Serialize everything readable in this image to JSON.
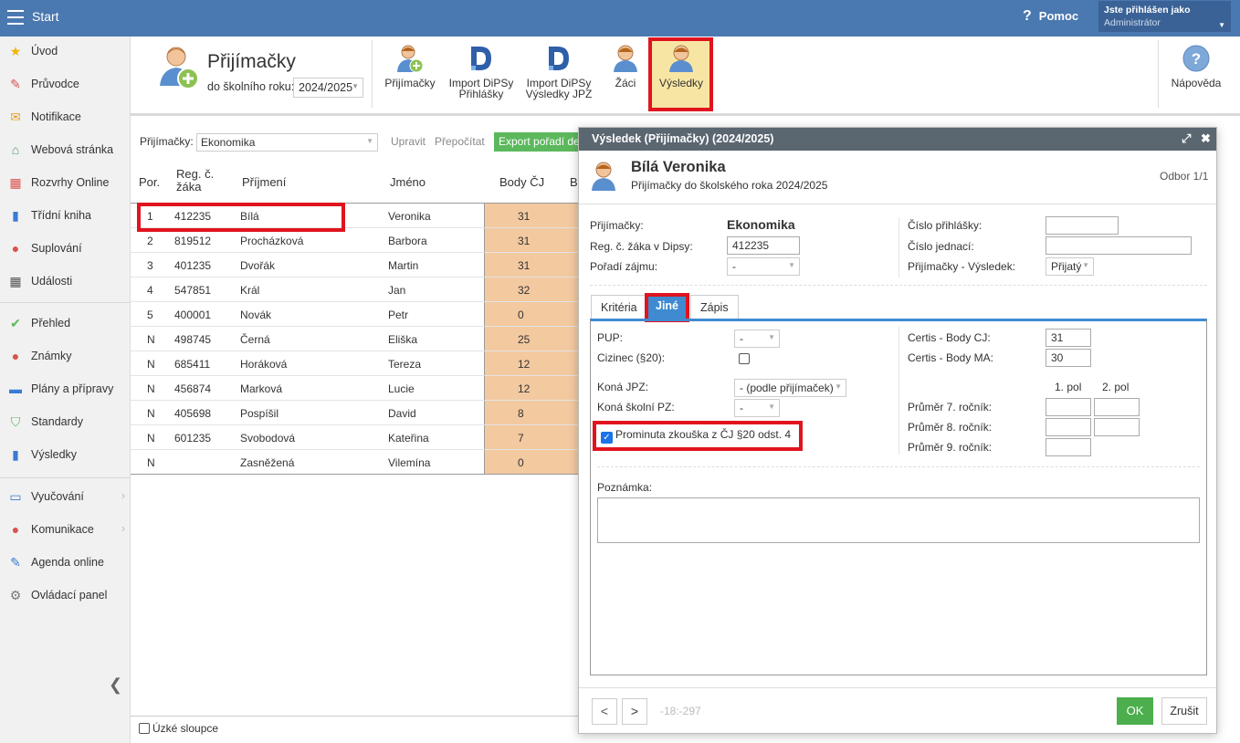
{
  "app": {
    "title": "Start",
    "help": "Pomoc",
    "help_q": "?",
    "user_line1": "Jste přihlášen jako",
    "user_line2": "Administrátor"
  },
  "sidebar": {
    "items": [
      {
        "label": "Úvod",
        "icon": "star-icon"
      },
      {
        "label": "Průvodce",
        "icon": "magic-wand-icon"
      },
      {
        "label": "Notifikace",
        "icon": "envelope-icon"
      },
      {
        "label": "Webová stránka",
        "icon": "home-icon"
      },
      {
        "label": "Rozvrhy Online",
        "icon": "calendar-icon"
      },
      {
        "label": "Třídní kniha",
        "icon": "book-icon"
      },
      {
        "label": "Suplování",
        "icon": "person-icon"
      },
      {
        "label": "Události",
        "icon": "calendar-grid-icon"
      },
      {
        "label": "Přehled",
        "icon": "check-circle-icon"
      },
      {
        "label": "Známky",
        "icon": "grade-icon"
      },
      {
        "label": "Plány a přípravy",
        "icon": "briefcase-icon"
      },
      {
        "label": "Standardy",
        "icon": "shield-icon"
      },
      {
        "label": "Výsledky",
        "icon": "bar-chart-icon"
      },
      {
        "label": "Vyučování",
        "icon": "book-open-icon"
      },
      {
        "label": "Komunikace",
        "icon": "chat-icon"
      },
      {
        "label": "Agenda online",
        "icon": "pen-icon"
      },
      {
        "label": "Ovládací panel",
        "icon": "gear-icon"
      }
    ]
  },
  "toolbar": {
    "title": "Přijímačky",
    "year_label": "do školního roku:",
    "year_value": "2024/2025",
    "btn_prijimacky": "Přijímačky",
    "btn_import1_l1": "Import DiPSy",
    "btn_import1_l2": "Přihlášky",
    "btn_import2_l1": "Import DiPSy",
    "btn_import2_l2": "Výsledky JPZ",
    "btn_zaci": "Žáci",
    "btn_vysledky": "Výsledky",
    "btn_napoveda": "Nápověda"
  },
  "list": {
    "filter_label": "Přijímačky:",
    "filter_value": "Ekonomika",
    "upravit": "Upravit",
    "prepocitat": "Přepočítat",
    "export": "Export pořadí de",
    "headers": {
      "por": "Por.",
      "reg1": "Reg. č.",
      "reg2": "žáka",
      "prijmeni": "Příjmení",
      "jmeno": "Jméno",
      "body_cj": "Body ČJ",
      "b": "B"
    },
    "rows": [
      {
        "por": "1",
        "reg": "412235",
        "prijmeni": "Bílá",
        "jmeno": "Veronika",
        "body": "31"
      },
      {
        "por": "2",
        "reg": "819512",
        "prijmeni": "Procházková",
        "jmeno": "Barbora",
        "body": "31"
      },
      {
        "por": "3",
        "reg": "401235",
        "prijmeni": "Dvořák",
        "jmeno": "Martin",
        "body": "31"
      },
      {
        "por": "4",
        "reg": "547851",
        "prijmeni": "Král",
        "jmeno": "Jan",
        "body": "32"
      },
      {
        "por": "5",
        "reg": "400001",
        "prijmeni": "Novák",
        "jmeno": "Petr",
        "body": "0"
      },
      {
        "por": "N",
        "reg": "498745",
        "prijmeni": "Černá",
        "jmeno": "Eliška",
        "body": "25"
      },
      {
        "por": "N",
        "reg": "685411",
        "prijmeni": "Horáková",
        "jmeno": "Tereza",
        "body": "12"
      },
      {
        "por": "N",
        "reg": "456874",
        "prijmeni": "Marková",
        "jmeno": "Lucie",
        "body": "12"
      },
      {
        "por": "N",
        "reg": "405698",
        "prijmeni": "Pospíšil",
        "jmeno": "David",
        "body": "8"
      },
      {
        "por": "N",
        "reg": "601235",
        "prijmeni": "Svobodová",
        "jmeno": "Kateřina",
        "body": "7"
      },
      {
        "por": "N",
        "reg": "",
        "prijmeni": "Zasněžená",
        "jmeno": "Vilemína",
        "body": "0"
      }
    ],
    "footer_checkbox": "Úzké sloupce"
  },
  "dialog": {
    "title": "Výsledek (Přijímačky) (2024/2025)",
    "name": "Bílá Veronika",
    "subtitle": "Přijímačky do školského roka 2024/2025",
    "odbor": "Odbor 1/1",
    "prijimacky_lbl": "Přijímačky:",
    "prijimacky_val": "Ekonomika",
    "reg_lbl": "Reg. č. žáka v Dipsy:",
    "reg_val": "412235",
    "poradi_lbl": "Pořadí zájmu:",
    "poradi_val": "-",
    "cislo_prihlasky_lbl": "Číslo přihlášky:",
    "cislo_jednaci_lbl": "Číslo jednací:",
    "vysledek_lbl": "Přijímačky - Výsledek:",
    "vysledek_val": "Přijatý",
    "tabs": [
      "Kritéria",
      "Jiné",
      "Zápis"
    ],
    "pup_lbl": "PUP:",
    "pup_val": "-",
    "cizinec_lbl": "Cizinec (§20):",
    "kona_jpz_lbl": "Koná JPZ:",
    "kona_jpz_val": "- (podle přijímaček)",
    "kona_pz_lbl": "Koná školní PZ:",
    "kona_pz_val": "-",
    "prominuta_lbl": "Prominuta zkouška z ČJ §20 odst. 4",
    "certis_cj_lbl": "Certis - Body CJ:",
    "certis_cj_val": "31",
    "certis_ma_lbl": "Certis - Body MA:",
    "certis_ma_val": "30",
    "pol1": "1. pol",
    "pol2": "2. pol",
    "prumer7": "Průměr 7. ročník:",
    "prumer8": "Průměr 8. ročník:",
    "prumer9": "Průměr 9. ročník:",
    "poznamka_lbl": "Poznámka:",
    "nav_prev": "<",
    "nav_next": ">",
    "nav_id": "-18:-297",
    "ok": "OK",
    "zrusit": "Zrušit"
  },
  "colors": {
    "topbar": "#4a78b0",
    "accent_tab": "#3f8ad0",
    "highlight": "#e0141e",
    "score_bg": "#f3c9a0",
    "ok_green": "#4cae4c"
  }
}
